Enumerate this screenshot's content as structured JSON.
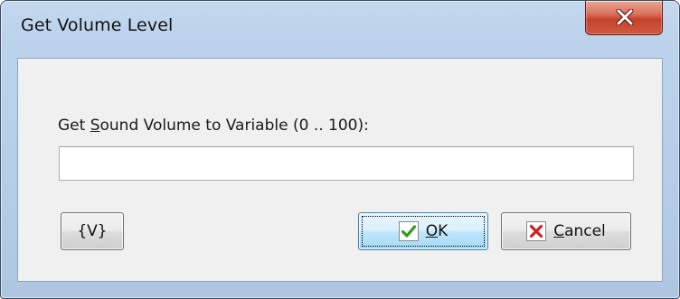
{
  "window": {
    "title": "Get Volume Level"
  },
  "form": {
    "prompt_prefix": "Get ",
    "prompt_mnemonic": "S",
    "prompt_suffix": "ound Volume to Variable (0 .. 100):",
    "input_value": ""
  },
  "buttons": {
    "variable_label": "{V}",
    "ok_mnemonic": "O",
    "ok_rest": "K",
    "cancel_mnemonic": "C",
    "cancel_rest": "ancel"
  },
  "colors": {
    "ok_check": "#2e9a1e",
    "cancel_x": "#d42020"
  },
  "icons": {
    "close": "close-icon",
    "ok": "checkmark-icon",
    "cancel": "x-icon"
  }
}
